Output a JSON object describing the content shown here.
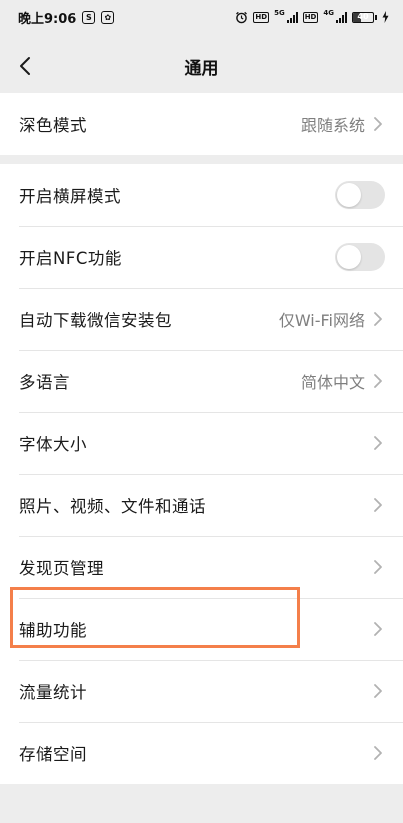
{
  "status_bar": {
    "time": "晚上9:06",
    "hd_label": "HD",
    "network_1": "5G",
    "network_2": "4G",
    "battery": "40",
    "battery_level": 0.4
  },
  "header": {
    "title": "通用"
  },
  "section_1": {
    "items": [
      {
        "label": "深色模式",
        "value": "跟随系统"
      }
    ]
  },
  "section_2": {
    "items": [
      {
        "label": "开启横屏模式",
        "toggle_on": false
      },
      {
        "label": "开启NFC功能",
        "toggle_on": false
      },
      {
        "label": "自动下载微信安装包",
        "value": "仅Wi-Fi网络"
      },
      {
        "label": "多语言",
        "value": "简体中文"
      },
      {
        "label": "字体大小"
      },
      {
        "label": "照片、视频、文件和通话"
      },
      {
        "label": "发现页管理"
      },
      {
        "label": "辅助功能"
      },
      {
        "label": "流量统计"
      },
      {
        "label": "存储空间"
      }
    ]
  },
  "colors": {
    "highlight": "#f47f4a",
    "background": "#ededed",
    "toggle_off": "#e4e4e4"
  }
}
